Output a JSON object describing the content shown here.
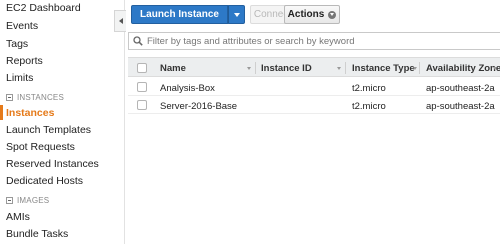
{
  "sidebar": {
    "items_top": [
      {
        "label": "EC2 Dashboard"
      },
      {
        "label": "Events"
      },
      {
        "label": "Tags"
      },
      {
        "label": "Reports"
      },
      {
        "label": "Limits"
      }
    ],
    "sections": [
      {
        "header": "INSTANCES",
        "items": [
          {
            "label": "Instances",
            "active": true
          },
          {
            "label": "Launch Templates"
          },
          {
            "label": "Spot Requests"
          },
          {
            "label": "Reserved Instances"
          },
          {
            "label": "Dedicated Hosts"
          }
        ]
      },
      {
        "header": "IMAGES",
        "items": [
          {
            "label": "AMIs"
          },
          {
            "label": "Bundle Tasks"
          }
        ]
      }
    ]
  },
  "toolbar": {
    "launch_label": "Launch Instance",
    "connect_label": "Connect",
    "actions_label": "Actions"
  },
  "filter": {
    "placeholder": "Filter by tags and attributes or search by keyword",
    "value": ""
  },
  "table": {
    "columns": [
      "Name",
      "Instance ID",
      "Instance Type",
      "Availability Zone"
    ],
    "rows": [
      {
        "name": "Analysis-Box",
        "instance_id": "",
        "instance_type": "t2.micro",
        "availability_zone": "ap-southeast-2a"
      },
      {
        "name": "Server-2016-Base",
        "instance_id": "",
        "instance_type": "t2.micro",
        "availability_zone": "ap-southeast-2a"
      }
    ]
  },
  "colors": {
    "accent": "#e57a1a",
    "primary_button": "#2d79c7"
  }
}
